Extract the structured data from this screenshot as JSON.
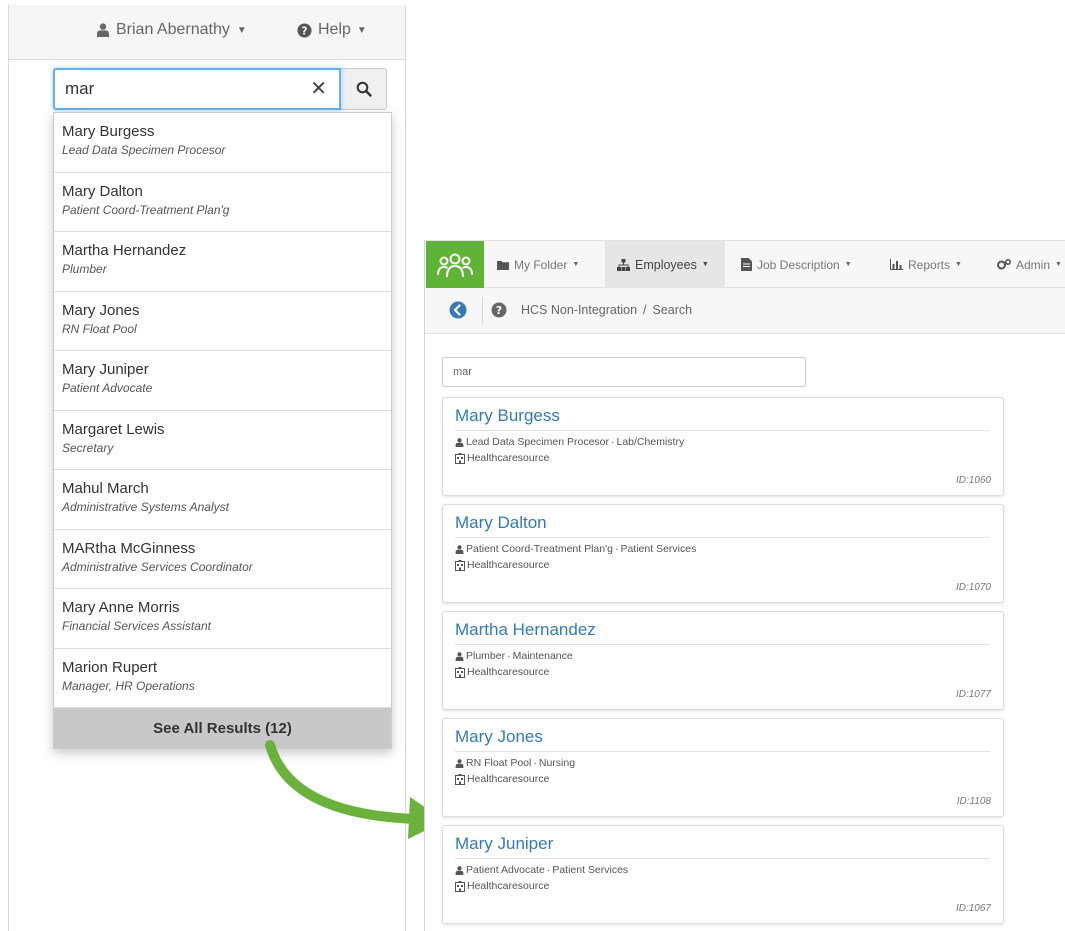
{
  "header": {
    "user_name": "Brian Abernathy",
    "help_label": "Help"
  },
  "search": {
    "value": "mar"
  },
  "dropdown": {
    "items": [
      {
        "name": "Mary Burgess",
        "title": "Lead Data Specimen Procesor"
      },
      {
        "name": "Mary Dalton",
        "title": "Patient Coord-Treatment Plan'g"
      },
      {
        "name": "Martha Hernandez",
        "title": "Plumber"
      },
      {
        "name": "Mary Jones",
        "title": "RN Float Pool"
      },
      {
        "name": "Mary Juniper",
        "title": "Patient Advocate"
      },
      {
        "name": "Margaret Lewis",
        "title": "Secretary"
      },
      {
        "name": "Mahul March",
        "title": "Administrative Systems Analyst"
      },
      {
        "name": "MARtha McGinness",
        "title": "Administrative Services Coordinator"
      },
      {
        "name": "Mary Anne Morris",
        "title": "Financial Services Assistant"
      },
      {
        "name": "Marion Rupert",
        "title": "Manager, HR Operations"
      }
    ],
    "footer": "See All Results (12)"
  },
  "navbar": {
    "items": [
      "My Folder",
      "Employees",
      "Job Description",
      "Reports",
      "Admin"
    ],
    "active": "Employees"
  },
  "breadcrumb": {
    "root": "HCS Non-Integration",
    "separator": "/",
    "current": "Search"
  },
  "results": {
    "search_value": "mar",
    "cards": [
      {
        "name": "Mary Burgess",
        "title": "Lead Data Specimen Procesor",
        "dept": "Lab/Chemistry",
        "org": "Healthcaresource",
        "id": "ID:1060"
      },
      {
        "name": "Mary Dalton",
        "title": "Patient Coord-Treatment Plan'g",
        "dept": "Patient Services",
        "org": "Healthcaresource",
        "id": "ID:1070"
      },
      {
        "name": "Martha Hernandez",
        "title": "Plumber",
        "dept": "Maintenance",
        "org": "Healthcaresource",
        "id": "ID:1077"
      },
      {
        "name": "Mary Jones",
        "title": "RN Float Pool",
        "dept": "Nursing",
        "org": "Healthcaresource",
        "id": "ID:1108"
      },
      {
        "name": "Mary Juniper",
        "title": "Patient Advocate",
        "dept": "Patient Services",
        "org": "Healthcaresource",
        "id": "ID:1067"
      }
    ],
    "meta_separator": "·"
  },
  "colors": {
    "brand_green": "#5fb336",
    "arrow_green": "#6ab23c",
    "link_blue": "#337ab7",
    "focus_blue": "#66afe9"
  }
}
